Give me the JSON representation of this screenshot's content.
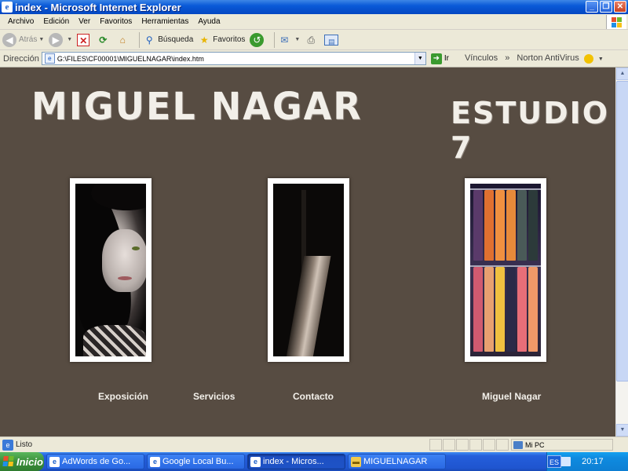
{
  "window": {
    "title": "index - Microsoft Internet Explorer",
    "buttons": [
      "_",
      "❐",
      "✕"
    ]
  },
  "menu": [
    "Archivo",
    "Edición",
    "Ver",
    "Favoritos",
    "Herramientas",
    "Ayuda"
  ],
  "toolbar": {
    "back": "Atrás",
    "search": "Búsqueda",
    "favorites": "Favoritos"
  },
  "address": {
    "label": "Dirección",
    "url": "G:\\FILES\\CF00001\\MIGUELNAGAR\\index.htm",
    "go": "Ir",
    "links": "Vínculos",
    "antivirus": "Norton AntiVirus"
  },
  "page": {
    "brand_left": "MIGUEL NAGAR",
    "brand_right": "ESTUDIO 7",
    "nav": [
      "Exposición",
      "Servicios",
      "Contacto",
      "Miguel Nagar"
    ]
  },
  "status": {
    "text": "Listo",
    "zone": "Mi PC"
  },
  "taskbar": {
    "start": "Inicio",
    "tasks": [
      "AdWords de Go...",
      "Google Local Bu...",
      "index - Micros...",
      "MIGUELNAGAR"
    ],
    "lang": "ES",
    "tray_chevron": "«",
    "time": "20:17"
  },
  "colors": {
    "page_bg": "#574c42",
    "link_color": "#f3f0ea",
    "title_bar": "#0a5ad8"
  }
}
